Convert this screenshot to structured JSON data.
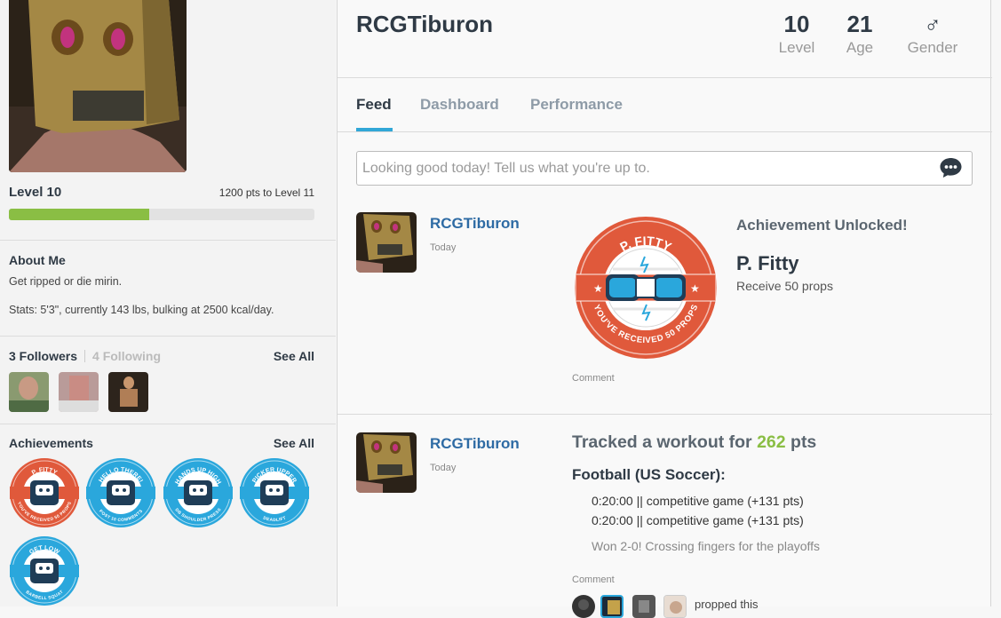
{
  "sidebar": {
    "level_label": "Level 10",
    "pts_to_next": "1200 pts to Level 11",
    "level_progress_fraction": 0.46,
    "about_title": "About Me",
    "about_text": "Get ripped or die mirin.",
    "stats_text": "Stats: 5'3\", currently 143 lbs, bulking at 2500 kcal/day.",
    "followers_label": "3 Followers",
    "following_label": "4 Following",
    "see_all_label": "See All",
    "achievements_title": "Achievements",
    "achievements_see_all": "See All",
    "badges": [
      {
        "top": "P. FITTY",
        "bottom": "YOU'VE RECEIVED 50 PROPS",
        "color": "#e0593b"
      },
      {
        "top": "HELLO THERE!",
        "bottom": "POST 10 COMMENTS",
        "color": "#2aa7dc"
      },
      {
        "top": "HANDS UP HIGH",
        "bottom": "DB SHOULDER PRESS",
        "color": "#2aa7dc"
      },
      {
        "top": "PICKER UPPER",
        "bottom": "DEADLIFT",
        "color": "#2aa7dc"
      },
      {
        "top": "GET LOW",
        "bottom": "BARBELL SQUAT",
        "color": "#2aa7dc"
      }
    ]
  },
  "profile": {
    "name": "RCGTiburon",
    "level_value": "10",
    "level_label": "Level",
    "age_value": "21",
    "age_label": "Age",
    "gender_symbol": "♂",
    "gender_label": "Gender"
  },
  "tabs": [
    "Feed",
    "Dashboard",
    "Performance"
  ],
  "status_placeholder": "Looking good today! Tell us what you're up to.",
  "feed": {
    "post1": {
      "user": "RCGTiburon",
      "time": "Today",
      "badge_top": "P. FITTY",
      "badge_bottom": "YOU'VE RECEIVED 50 PROPS",
      "headline": "Achievement Unlocked!",
      "title": "P. Fitty",
      "desc": "Receive 50 props",
      "comment": "Comment"
    },
    "post2": {
      "user": "RCGTiburon",
      "time": "Today",
      "tracked_prefix": "Tracked a workout for",
      "tracked_pts": "262",
      "tracked_suffix": "pts",
      "sport": "Football (US Soccer):",
      "sets": [
        "0:20:00 || competitive game (+131 pts)",
        "0:20:00 || competitive game (+131 pts)"
      ],
      "note": "Won 2-0! Crossing fingers for the playoffs",
      "comment": "Comment",
      "propped": "propped this"
    }
  },
  "colors": {
    "accent": "#31a7d7",
    "green": "#8abe44",
    "link": "#2e6ba4",
    "badge_orange": "#e0593b",
    "badge_blue": "#2aa7dc"
  }
}
